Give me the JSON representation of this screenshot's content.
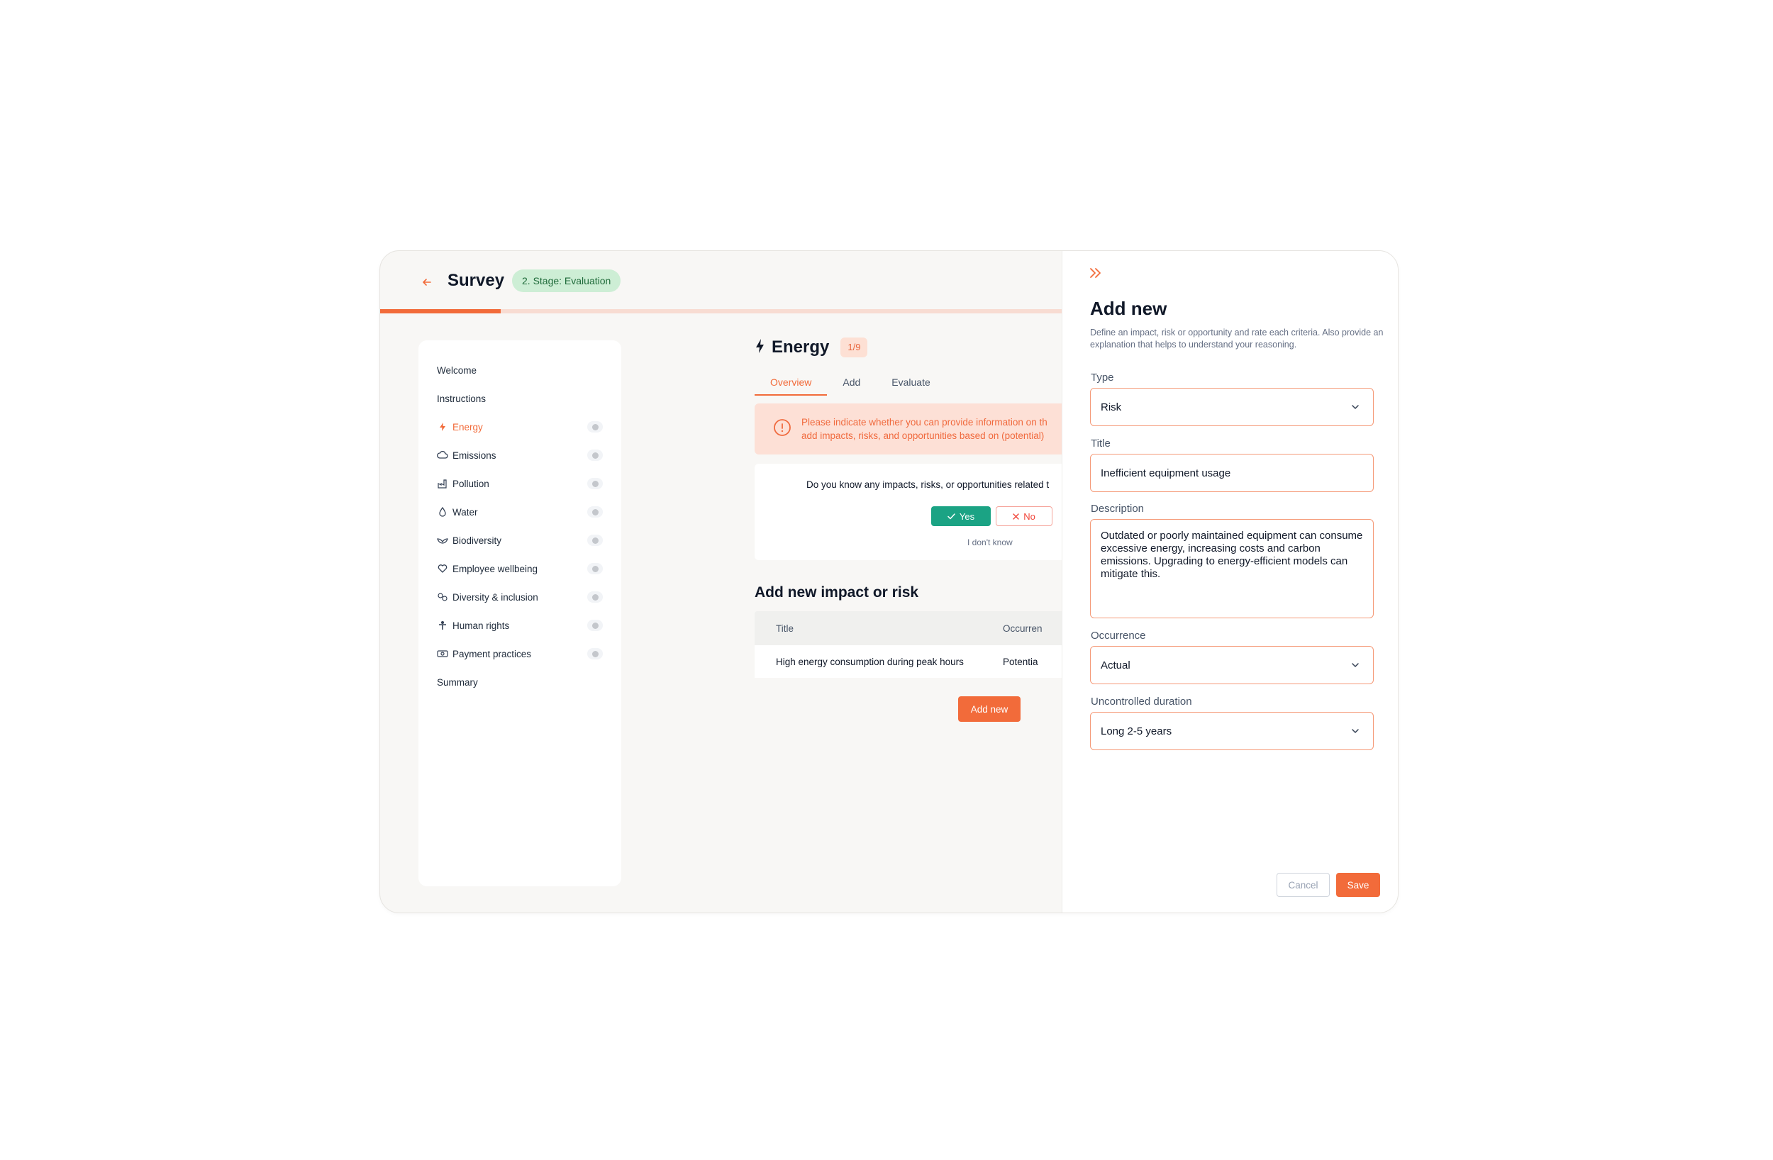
{
  "header": {
    "title": "Survey",
    "stage_badge": "2. Stage: Evaluation",
    "progress_fraction": 0.176
  },
  "sidebar": {
    "items": [
      {
        "label": "Welcome",
        "icon": "",
        "has_status": false,
        "active": false
      },
      {
        "label": "Instructions",
        "icon": "",
        "has_status": false,
        "active": false
      },
      {
        "label": "Energy",
        "icon": "lightning-icon",
        "has_status": true,
        "active": true
      },
      {
        "label": "Emissions",
        "icon": "cloud-icon",
        "has_status": true,
        "active": false
      },
      {
        "label": "Pollution",
        "icon": "factory-icon",
        "has_status": true,
        "active": false
      },
      {
        "label": "Water",
        "icon": "droplet-icon",
        "has_status": true,
        "active": false
      },
      {
        "label": "Biodiversity",
        "icon": "bird-icon",
        "has_status": true,
        "active": false
      },
      {
        "label": "Employee wellbeing",
        "icon": "heart-icon",
        "has_status": true,
        "active": false
      },
      {
        "label": "Diversity & inclusion",
        "icon": "people-icon",
        "has_status": true,
        "active": false
      },
      {
        "label": "Human rights",
        "icon": "person-icon",
        "has_status": true,
        "active": false
      },
      {
        "label": "Payment practices",
        "icon": "money-icon",
        "has_status": true,
        "active": false
      },
      {
        "label": "Summary",
        "icon": "",
        "has_status": false,
        "active": false
      }
    ]
  },
  "main": {
    "section_title": "Energy",
    "section_icon": "lightning-icon",
    "count_badge": "1/9",
    "tabs": [
      {
        "label": "Overview",
        "active": true
      },
      {
        "label": "Add",
        "active": false
      },
      {
        "label": "Evaluate",
        "active": false
      }
    ],
    "alert_line1": "Please indicate whether you can provide information on th",
    "alert_line2": "add impacts, risks, and opportunities based on (potential)",
    "question": "Do you know any impacts, risks, or opportunities related t",
    "yes_label": "Yes",
    "no_label": "No",
    "dont_know_label": "I don't know",
    "add_heading": "Add new impact or risk",
    "table": {
      "columns": [
        "Title",
        "Occurren"
      ],
      "rows": [
        [
          "High energy consumption during peak hours",
          "Potentia"
        ]
      ]
    },
    "add_new_label": "Add new"
  },
  "drawer": {
    "title": "Add new",
    "description": "Define an impact, risk or opportunity and rate each criteria. Also provide an explanation that helps to understand your reasoning.",
    "type_label": "Type",
    "type_value": "Risk",
    "title_label": "Title",
    "title_value": "Inefficient equipment usage",
    "description_label": "Description",
    "description_value": "Outdated or poorly maintained equipment can consume excessive energy, increasing costs and carbon emissions. Upgrading to energy-efficient models can mitigate this.",
    "occurrence_label": "Occurrence",
    "occurrence_value": "Actual",
    "duration_label": "Uncontrolled duration",
    "duration_value": "Long 2-5 years",
    "cancel_label": "Cancel",
    "save_label": "Save"
  },
  "colors": {
    "accent": "#f26b3a",
    "success": "#1ba384",
    "badge_green_bg": "#cdeed5",
    "alert_bg": "#fde0d6"
  }
}
